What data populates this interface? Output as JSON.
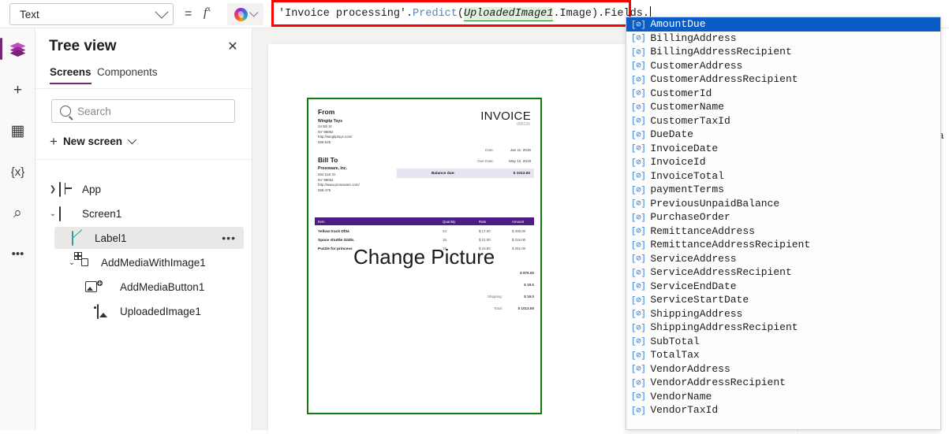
{
  "topbar": {
    "property_selected": "Text",
    "equals_symbol": "=",
    "fx_symbol": "fx",
    "copilot_icon": "copilot-icon",
    "chevron_icon": "chevron-down-icon"
  },
  "formula": {
    "datasource": "'Invoice processing'",
    "dot1": ".",
    "function": "Predict",
    "open_paren": "(",
    "argument": "UploadedImage1",
    "arg_suffix": ".Image",
    "close_paren": ")",
    "tail": ".Fields.",
    "full_text": "'Invoice processing'.Predict(UploadedImage1.Image).Fields."
  },
  "annotation": {
    "highlight_color": "#ff0000"
  },
  "rail": {
    "items": [
      {
        "icon": "layers-icon",
        "name": "tree-view",
        "active": true
      },
      {
        "icon": "plus-icon",
        "name": "insert",
        "glyph": "+",
        "active": false
      },
      {
        "icon": "table-icon",
        "name": "data",
        "glyph": "▦",
        "active": false
      },
      {
        "icon": "variables-icon",
        "name": "variables",
        "glyph": "{x}",
        "active": false
      },
      {
        "icon": "search-icon",
        "name": "search",
        "glyph": "⌕",
        "active": false
      },
      {
        "icon": "more-icon",
        "name": "more",
        "glyph": "•••",
        "active": false
      }
    ],
    "accent": "#742774"
  },
  "tree": {
    "title": "Tree view",
    "close_icon": "close-icon",
    "tabs": [
      {
        "label": "Screens",
        "active": true
      },
      {
        "label": "Components",
        "active": false
      }
    ],
    "search_placeholder": "Search",
    "new_screen_label": "New screen",
    "nodes": [
      {
        "label": "App",
        "icon": "app-icon",
        "indent": 0,
        "twisty": "collapsed",
        "selected": false
      },
      {
        "label": "Screen1",
        "icon": "screen-icon",
        "indent": 0,
        "twisty": "expanded",
        "selected": false
      },
      {
        "label": "Label1",
        "icon": "label-icon",
        "indent": 1,
        "twisty": "none",
        "selected": true,
        "overflow": "•••"
      },
      {
        "label": "AddMediaWithImage1",
        "icon": "group-icon",
        "indent": 1,
        "twisty": "expanded",
        "selected": false
      },
      {
        "label": "AddMediaButton1",
        "icon": "add-media-icon",
        "indent": 2,
        "twisty": "none",
        "selected": false
      },
      {
        "label": "UploadedImage1",
        "icon": "image-icon",
        "indent": 2,
        "twisty": "none",
        "selected": false
      }
    ]
  },
  "canvas": {
    "label_text": "Change Picture",
    "selection_color": "#a97fc4",
    "image_border_color": "#107c10",
    "delete_button": "×",
    "invoice": {
      "from_heading": "From",
      "from_company": "Wingtip Toys",
      "from_line1": "34 5th St",
      "from_line2": "NY 98052",
      "from_url": "http://wingtiptoys.com/",
      "from_phone": "555-525",
      "billto_heading": "Bill To",
      "billto_company": "Prosoware, Inc.",
      "billto_line1": "654 11st St",
      "billto_line2": "NY 98052",
      "billto_url": "http://www.prosoware.com/",
      "billto_phone": "555-475",
      "title": "INVOICE",
      "number": "085236",
      "date_label": "Date:",
      "date_value": "Jan 11, 2019",
      "duedate_label": "Due Date:",
      "duedate_value": "May 12, 2019",
      "balance_label": "Balance due:",
      "balance_value": "$ 1013.50",
      "columns": [
        "Item",
        "Quantity",
        "Rate",
        "Amount"
      ],
      "rows": [
        {
          "item": "Yellow truck Df34",
          "qty": "24",
          "rate": "$ 17.00",
          "amount": "$ 408.00"
        },
        {
          "item": "Space shuttle 3240L",
          "qty": "15",
          "rate": "$ 21.00",
          "amount": "$ 315.00"
        },
        {
          "item": "Puzzle for princess",
          "qty": "15",
          "rate": "$ 16.80",
          "amount": "$ 252.00"
        }
      ],
      "totals": [
        {
          "label": "",
          "value": "$ 975.00"
        },
        {
          "label": "",
          "value": "$ 19.5"
        },
        {
          "label": "Shipping:",
          "value": "$ 19.0"
        },
        {
          "label": "Total:",
          "value": "$ 1013.50"
        }
      ]
    }
  },
  "right_panel": {
    "partial_text": "a"
  },
  "intellisense": {
    "icon_glyph": "[⊘]",
    "selected_index": 0,
    "items": [
      "AmountDue",
      "BillingAddress",
      "BillingAddressRecipient",
      "CustomerAddress",
      "CustomerAddressRecipient",
      "CustomerId",
      "CustomerName",
      "CustomerTaxId",
      "DueDate",
      "InvoiceDate",
      "InvoiceId",
      "InvoiceTotal",
      "paymentTerms",
      "PreviousUnpaidBalance",
      "PurchaseOrder",
      "RemittanceAddress",
      "RemittanceAddressRecipient",
      "ServiceAddress",
      "ServiceAddressRecipient",
      "ServiceEndDate",
      "ServiceStartDate",
      "ShippingAddress",
      "ShippingAddressRecipient",
      "SubTotal",
      "TotalTax",
      "VendorAddress",
      "VendorAddressRecipient",
      "VendorName",
      "VendorTaxId"
    ]
  }
}
